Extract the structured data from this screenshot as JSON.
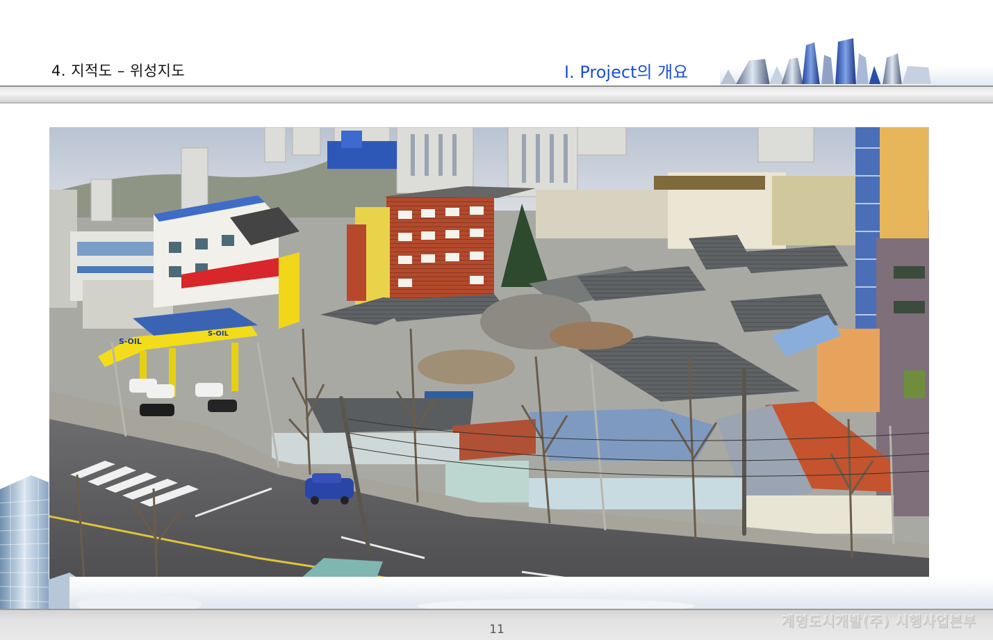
{
  "header": {
    "page_title": "4. 지적도 – 위성지도",
    "section_title": "Ⅰ.  Project의 개요"
  },
  "photo": {
    "subject": "street-level aerial photo of a dense low-rise neighbourhood",
    "sign_text": "S-OIL"
  },
  "footer": {
    "page_number": "11",
    "company": "계명도시개발(주)  시행사업본부"
  },
  "icons": {
    "skyline": "city-skyline-graphic",
    "decoration": "glass-tower-graphic"
  },
  "colors": {
    "section_title": "#1a4fd6",
    "header_text": "#111111",
    "rule": "#8c8c8c",
    "footer_text": "#d6d6d6"
  }
}
